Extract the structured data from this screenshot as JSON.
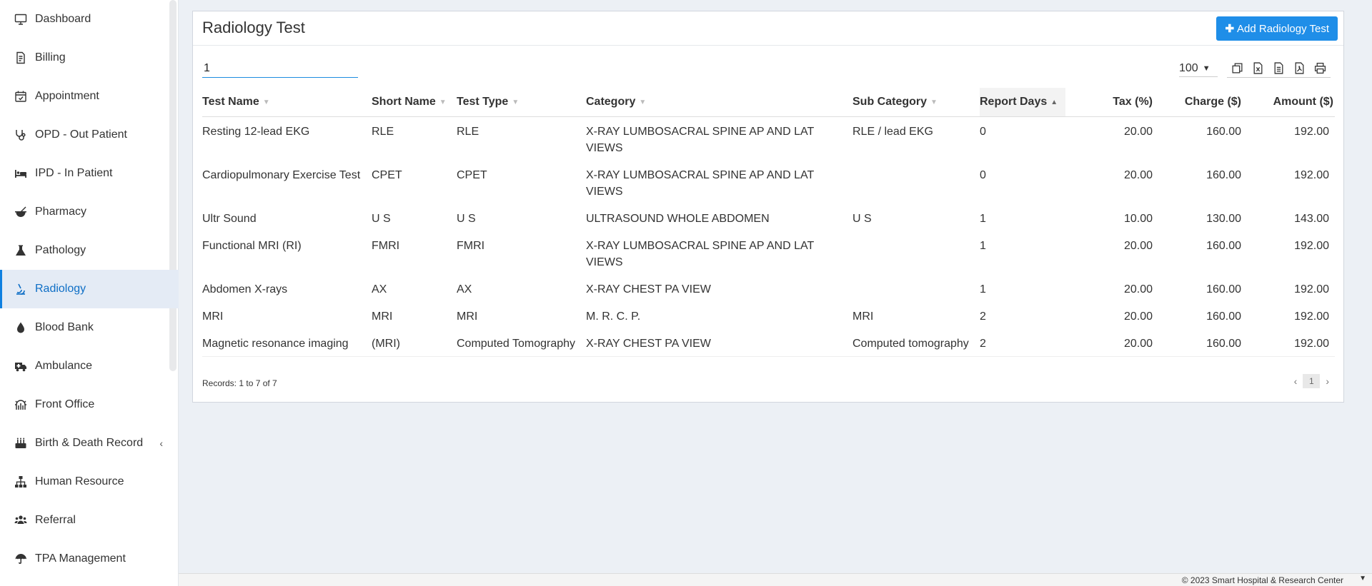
{
  "sidebar": {
    "items": [
      {
        "label": "Dashboard",
        "icon": "monitor-icon"
      },
      {
        "label": "Billing",
        "icon": "invoice-icon"
      },
      {
        "label": "Appointment",
        "icon": "calendar-check-icon"
      },
      {
        "label": "OPD - Out Patient",
        "icon": "stethoscope-icon"
      },
      {
        "label": "IPD - In Patient",
        "icon": "bed-icon"
      },
      {
        "label": "Pharmacy",
        "icon": "mortar-pestle-icon"
      },
      {
        "label": "Pathology",
        "icon": "flask-icon"
      },
      {
        "label": "Radiology",
        "icon": "microscope-icon"
      },
      {
        "label": "Blood Bank",
        "icon": "tint-icon"
      },
      {
        "label": "Ambulance",
        "icon": "ambulance-icon"
      },
      {
        "label": "Front Office",
        "icon": "dungeon-icon"
      },
      {
        "label": "Birth & Death Record",
        "icon": "birthday-cake-icon"
      },
      {
        "label": "Human Resource",
        "icon": "sitemap-icon"
      },
      {
        "label": "Referral",
        "icon": "users-icon"
      },
      {
        "label": "TPA Management",
        "icon": "umbrella-icon"
      }
    ],
    "active": "Radiology"
  },
  "main": {
    "title": "Radiology Test",
    "add_button_label": "Add Radiology Test",
    "search_value": "1",
    "page_size": "100",
    "columns": [
      "Test Name",
      "Short Name",
      "Test Type",
      "Category",
      "Sub Category",
      "Report Days",
      "Tax (%)",
      "Charge ($)",
      "Amount ($)"
    ],
    "rows": [
      {
        "test_name": "Resting 12-lead EKG",
        "short_name": "RLE",
        "test_type": "RLE",
        "category": "X-RAY LUMBOSACRAL SPINE AP AND LAT VIEWS",
        "sub_category": "RLE / lead EKG",
        "report_days": "0",
        "tax": "20.00",
        "charge": "160.00",
        "amount": "192.00"
      },
      {
        "test_name": "Cardiopulmonary Exercise Test",
        "short_name": "CPET",
        "test_type": "CPET",
        "category": "X-RAY LUMBOSACRAL SPINE AP AND LAT VIEWS",
        "sub_category": "",
        "report_days": "0",
        "tax": "20.00",
        "charge": "160.00",
        "amount": "192.00"
      },
      {
        "test_name": "Ultr Sound",
        "short_name": "U S",
        "test_type": "U S",
        "category": "ULTRASOUND WHOLE ABDOMEN",
        "sub_category": "U S",
        "report_days": "1",
        "tax": "10.00",
        "charge": "130.00",
        "amount": "143.00"
      },
      {
        "test_name": "Functional MRI (RI)",
        "short_name": "FMRI",
        "test_type": "FMRI",
        "category": "X-RAY LUMBOSACRAL SPINE AP AND LAT VIEWS",
        "sub_category": "",
        "report_days": "1",
        "tax": "20.00",
        "charge": "160.00",
        "amount": "192.00"
      },
      {
        "test_name": "Abdomen X-rays",
        "short_name": "AX",
        "test_type": "AX",
        "category": "X-RAY CHEST PA VIEW",
        "sub_category": "",
        "report_days": "1",
        "tax": "20.00",
        "charge": "160.00",
        "amount": "192.00"
      },
      {
        "test_name": "MRI",
        "short_name": "MRI",
        "test_type": "MRI",
        "category": "M. R. C. P.",
        "sub_category": "MRI",
        "report_days": "2",
        "tax": "20.00",
        "charge": "160.00",
        "amount": "192.00"
      },
      {
        "test_name": "Magnetic resonance imaging",
        "short_name": "(MRI)",
        "test_type": "Computed Tomography",
        "category": "X-RAY CHEST PA VIEW",
        "sub_category": "Computed tomography",
        "report_days": "2",
        "tax": "20.00",
        "charge": "160.00",
        "amount": "192.00"
      }
    ],
    "records_text": "Records: 1 to 7 of 7",
    "current_page": "1"
  },
  "footer": {
    "copyright": "© 2023 Smart Hospital & Research Center"
  },
  "colors": {
    "accent": "#1f8ee8",
    "active_bg": "#e4ebf5",
    "page_bg": "#ecf0f5"
  }
}
